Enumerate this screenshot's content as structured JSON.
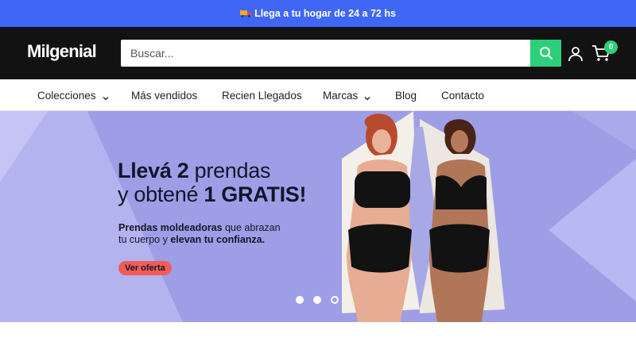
{
  "announcement": {
    "text": "Llega a tu hogar de 24 a 72 hs",
    "icon": "truck-icon"
  },
  "header": {
    "logo": "Milgenial",
    "search": {
      "placeholder": "Buscar...",
      "value": ""
    },
    "cart_count": "0",
    "colors": {
      "background": "#121212",
      "accent": "#2ecf7a"
    }
  },
  "nav": {
    "items": [
      {
        "label": "Colecciones",
        "has_dropdown": true
      },
      {
        "label": "Más vendidos",
        "has_dropdown": false
      },
      {
        "label": "Recien Llegados",
        "has_dropdown": false
      },
      {
        "label": "Marcas",
        "has_dropdown": true
      },
      {
        "label": "Blog",
        "has_dropdown": false
      },
      {
        "label": "Contacto",
        "has_dropdown": false
      }
    ]
  },
  "hero": {
    "title_line1_bold": "Llevá 2",
    "title_line1_rest": " prendas",
    "title_line2_pre": "y obtené ",
    "title_line2_bold": "1 GRATIS!",
    "sub_bold1": "Prendas moldeadoras",
    "sub_text1": " que abrazan",
    "sub_text2": "tu cuerpo y ",
    "sub_bold2": "elevan tu confianza.",
    "cta": "Ver oferta",
    "slides_total": 3,
    "active_slide": 3,
    "colors": {
      "background": "#9d9ee6",
      "cta": "#f25c57"
    }
  },
  "announcement_color": "#3f66f5"
}
